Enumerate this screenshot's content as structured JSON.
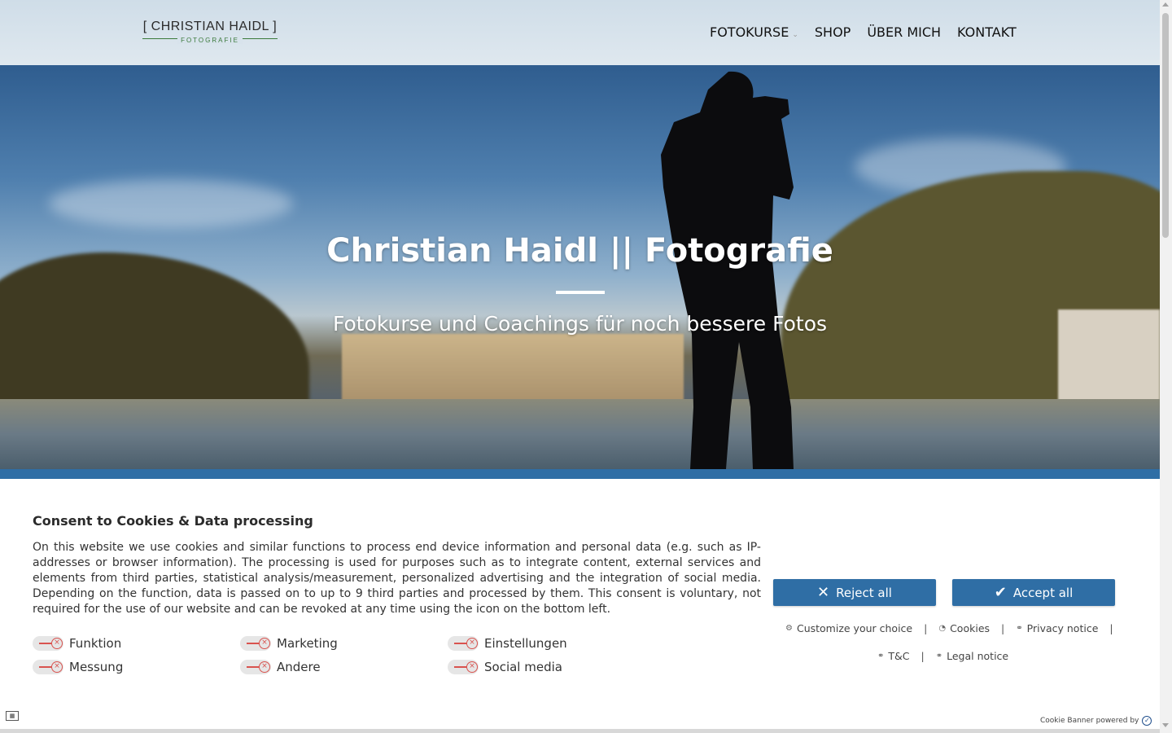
{
  "header": {
    "logo_main": "[ CHRISTIAN HAIDL ]",
    "logo_sub": "FOTOGRAFIE",
    "nav": [
      {
        "label": "FOTOKURSE",
        "has_dropdown": true
      },
      {
        "label": "SHOP"
      },
      {
        "label": "ÜBER MICH"
      },
      {
        "label": "KONTAKT"
      }
    ]
  },
  "hero": {
    "title": "Christian Haidl || Fotografie",
    "subtitle": "Fotokurse und Coachings für noch bessere Fotos"
  },
  "cookie_banner": {
    "title": "Consent to Cookies & Data processing",
    "text": "On this website we use cookies and similar functions to process end device information and personal data (e.g. such as IP-addresses or browser information). The processing is used for purposes such as to integrate content, external services and elements from third parties, statistical analysis/measurement, personalized advertising and the integration of social media. Depending on the function, data is passed on to up to 9 third parties and processed by them. This consent is voluntary, not required for the use of our website and can be revoked at any time using the icon on the bottom left.",
    "categories": [
      {
        "label": "Funktion",
        "enabled": false
      },
      {
        "label": "Marketing",
        "enabled": false
      },
      {
        "label": "Einstellungen",
        "enabled": false
      },
      {
        "label": "Messung",
        "enabled": false
      },
      {
        "label": "Andere",
        "enabled": false
      },
      {
        "label": "Social media",
        "enabled": false
      }
    ],
    "reject_label": "Reject all",
    "accept_label": "Accept all",
    "links_row1": [
      "Customize your choice",
      "Cookies",
      "Privacy notice"
    ],
    "links_row2": [
      "T&C",
      "Legal notice"
    ],
    "powered_by": "Cookie Banner powered by",
    "accent_color": "#2f6ea5"
  }
}
